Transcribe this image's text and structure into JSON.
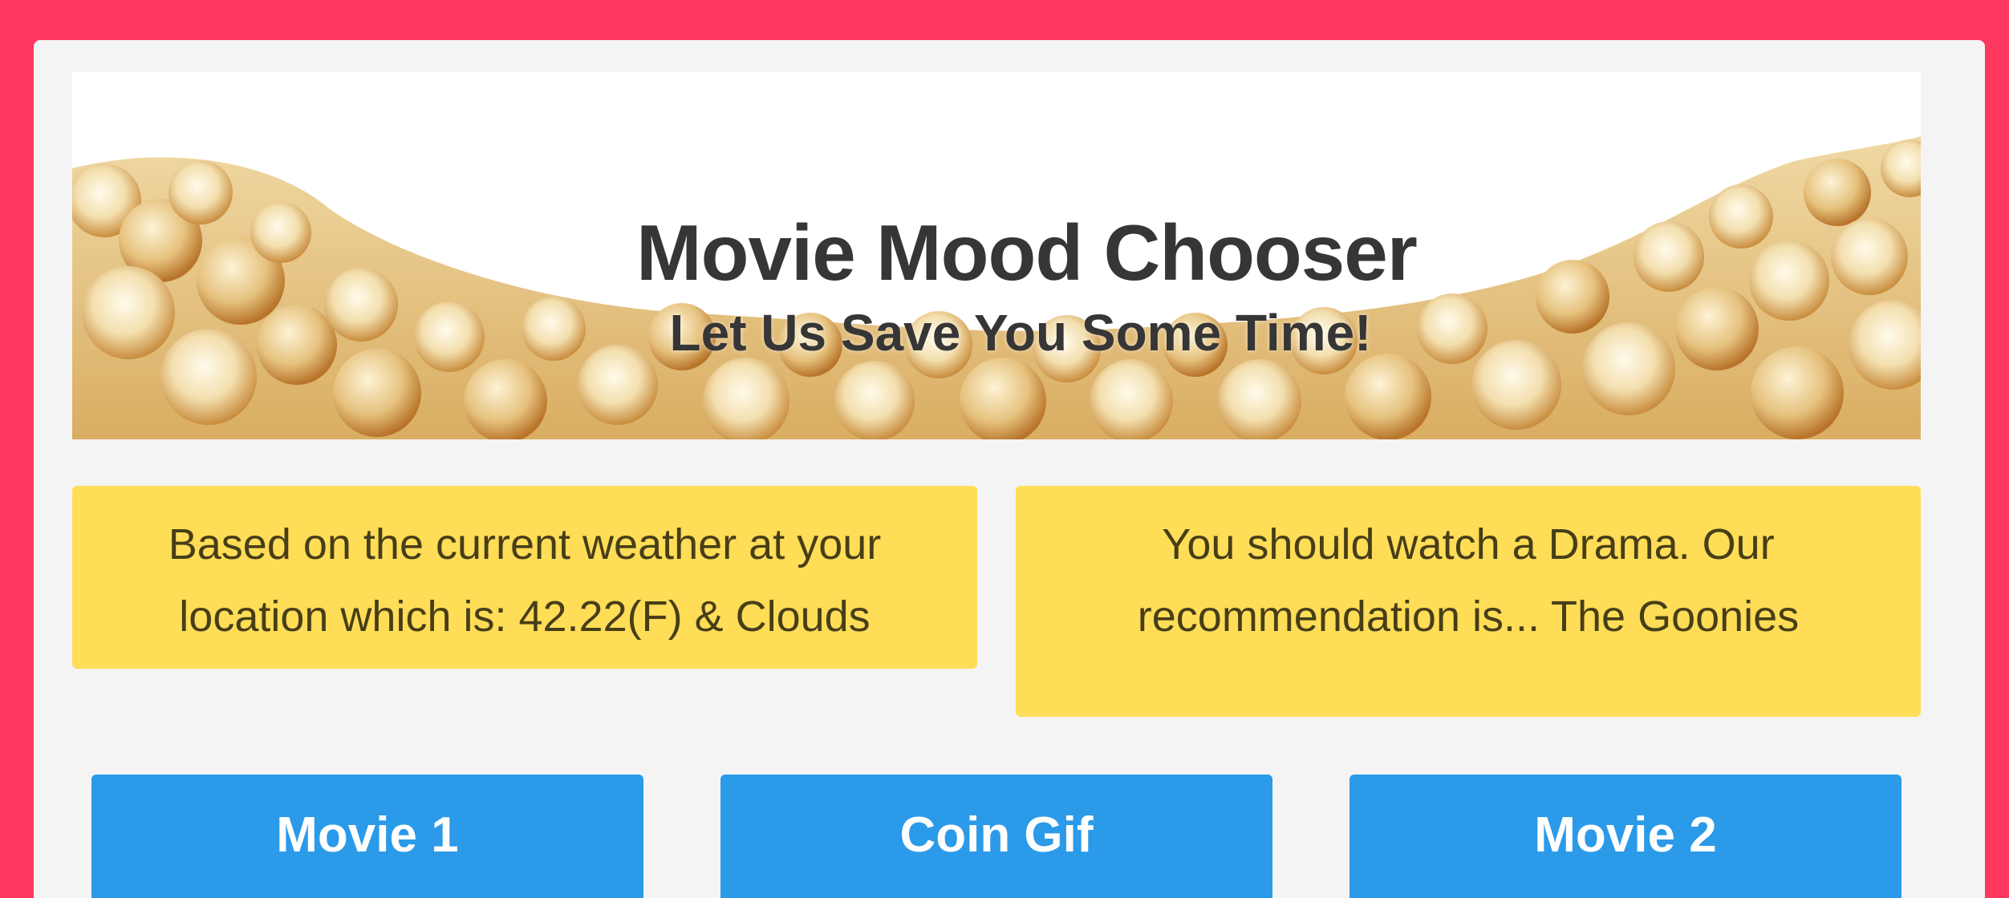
{
  "colors": {
    "page_background": "#ff3860",
    "panel_background": "#f4f4f4",
    "info_box": "#ffdd57",
    "button": "#2b9ae9",
    "title_text": "#363636"
  },
  "banner": {
    "title": "Movie Mood Chooser",
    "subtitle": "Let Us Save You Some Time!",
    "image": "popcorn-image"
  },
  "weather_box": {
    "line1": "Based on the current weather at your",
    "line2": "location which is: 42.22(F) & Clouds"
  },
  "recommendation_box": {
    "line1": "You should watch a Drama. Our",
    "line2": "recommendation is... The Goonies"
  },
  "buttons": [
    {
      "label": "Movie 1"
    },
    {
      "label": "Coin Gif"
    },
    {
      "label": "Movie 2"
    }
  ]
}
